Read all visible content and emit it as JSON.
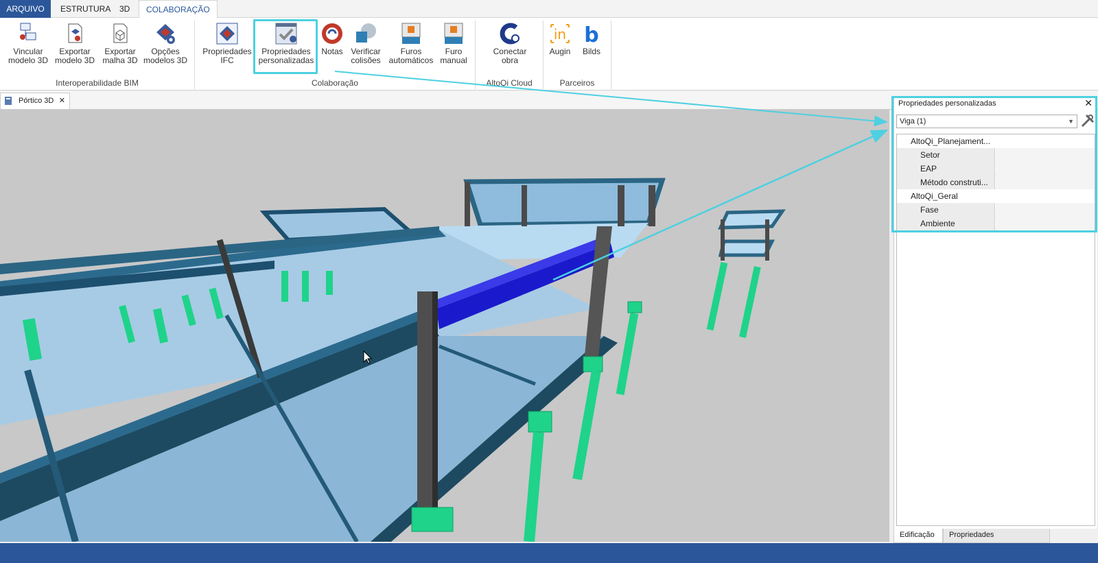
{
  "ribbon_tabs": [
    "ARQUIVO",
    "ESTRUTURA",
    "3D",
    "COLABORAÇÃO"
  ],
  "groups": {
    "interop": {
      "label": "Interoperabilidade BIM",
      "buttons": [
        "Vincular\nmodelo 3D",
        "Exportar\nmodelo 3D",
        "Exportar\nmalha 3D",
        "Opções\nmodelos 3D"
      ]
    },
    "colab": {
      "label": "Colaboração",
      "buttons": [
        "Propriedades\nIFC",
        "Propriedades\npersonalizadas",
        "Notas",
        "Verificar\ncolisões",
        "Furos\nautomáticos",
        "Furo\nmanual"
      ]
    },
    "cloud": {
      "label": "AltoQi Cloud",
      "buttons": [
        "Conectar\nobra"
      ]
    },
    "partners": {
      "label": "Parceiros",
      "buttons": [
        "Augin",
        "Bilds"
      ]
    }
  },
  "doc_tab": {
    "label": "Pórtico 3D",
    "close": "✕"
  },
  "panel": {
    "title": "Propriedades personalizadas",
    "close": "✕",
    "combo_value": "Viga (1)",
    "categories": [
      {
        "name": "AltoQi_Planejament...",
        "props": [
          "Setor",
          "EAP",
          "Método construti..."
        ]
      },
      {
        "name": "AltoQi_Geral",
        "props": [
          "Fase",
          "Ambiente"
        ]
      }
    ],
    "bottom_tabs": [
      "Edificação",
      "Propriedades personalizadas"
    ]
  },
  "colors": {
    "accent": "#2b579a",
    "highlight": "#4dd0e1",
    "selected_beam": "#1a1acc",
    "beam": "#2f6b8a",
    "slab": "#7fb2d8",
    "pile": "#1fd38a"
  }
}
